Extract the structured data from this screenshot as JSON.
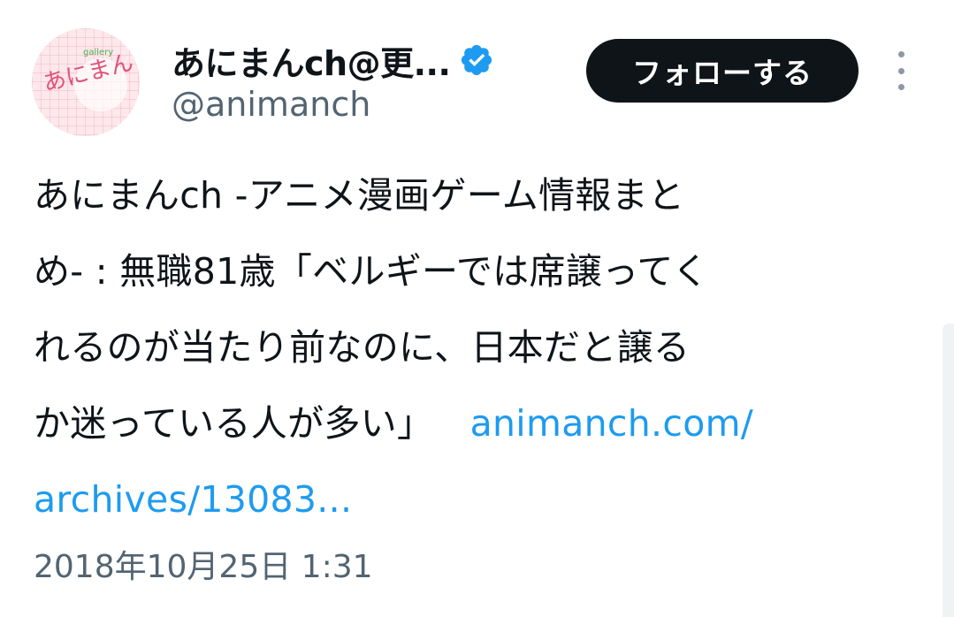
{
  "author": {
    "display_name": "あにまんch@更...",
    "handle": "@animanch",
    "verified": true,
    "avatar_text": "あにまんch"
  },
  "actions": {
    "follow_label": "フォローする"
  },
  "tweet": {
    "lines": [
      "あにまんch -アニメ漫画ゲーム情報まと",
      "め- : 無職81歳「ベルギーでは席譲ってく",
      "れるのが当たり前なのに、日本だと譲る",
      "か迷っている人が多い」"
    ],
    "link_part1": "animanch.com/",
    "link_part2": "archives/13083...",
    "timestamp": "2018年10月25日 1:31"
  },
  "colors": {
    "link": "#1d9bf0",
    "verified": "#1d9bf0",
    "follow_bg": "#0f1419",
    "secondary_text": "#536471"
  }
}
